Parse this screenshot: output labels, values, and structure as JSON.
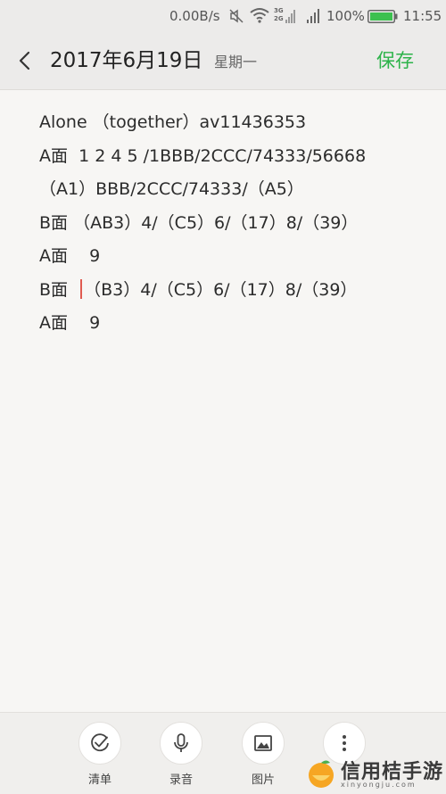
{
  "status": {
    "speed": "0.00B/s",
    "network_labels": [
      "3G",
      "2G"
    ],
    "battery": "100%",
    "time": "11:55"
  },
  "header": {
    "date": "2017年6月19日",
    "weekday": "星期一",
    "save_label": "保存"
  },
  "note": {
    "lines": [
      "Alone （together）av11436353",
      "A面  1 2 4 5 /1BBB/2CCC/74333/56668",
      "（A1）BBB/2CCC/74333/（A5）",
      "B面 （AB3）4/（C5）6/（17）8/（39）",
      "A面    9",
      "（B3）4/（C5）6/（17）8/（39）",
      "A面    9"
    ],
    "cursor_line_prefix": "B面  "
  },
  "toolbar": {
    "checklist_label": "清单",
    "record_label": "录音",
    "image_label": "图片"
  },
  "watermark": {
    "text": "信用桔手游",
    "sub": "xinyongju.com"
  },
  "colors": {
    "accent_green": "#2db34a",
    "caret_red": "#e05a50"
  }
}
